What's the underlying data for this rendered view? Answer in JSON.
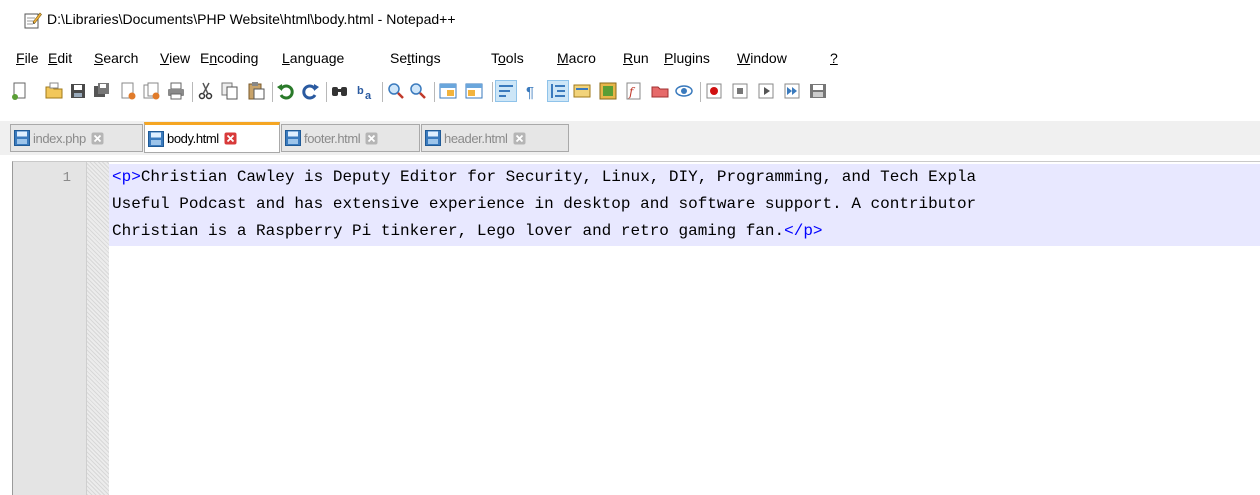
{
  "window": {
    "title": "D:\\Libraries\\Documents\\PHP Website\\html\\body.html - Notepad++",
    "icon": "notepad-plus-plus-icon"
  },
  "menu": [
    {
      "accel": "F",
      "rest": "ile"
    },
    {
      "accel": "E",
      "rest": "dit"
    },
    {
      "accel": "S",
      "rest": "earch"
    },
    {
      "accel": "V",
      "rest": "iew"
    },
    {
      "pre": "E",
      "accel": "n",
      "rest": "coding"
    },
    {
      "accel": "L",
      "rest": "anguage"
    },
    {
      "pre": "Se",
      "accel": "t",
      "rest": "tings"
    },
    {
      "pre": "T",
      "accel": "o",
      "rest": "ols"
    },
    {
      "accel": "M",
      "rest": "acro"
    },
    {
      "accel": "R",
      "rest": "un"
    },
    {
      "accel": "P",
      "rest": "lugins"
    },
    {
      "accel": "W",
      "rest": "indow"
    },
    {
      "accel": "?",
      "rest": ""
    }
  ],
  "toolbar": [
    "new-file-icon",
    "open-file-icon",
    "save-icon",
    "save-all-icon",
    "close-icon",
    "close-all-icon",
    "print-icon",
    "cut-icon",
    "copy-icon",
    "paste-icon",
    "undo-icon",
    "redo-icon",
    "find-icon",
    "replace-icon",
    "zoom-in-icon",
    "zoom-out-icon",
    "sync-vertical-icon",
    "sync-horizontal-icon",
    "word-wrap-icon",
    "show-all-chars-icon",
    "indent-guide-icon",
    "language-icon",
    "document-map-icon",
    "function-list-icon",
    "folder-workspace-icon",
    "monitoring-icon",
    "record-macro-icon",
    "stop-record-icon",
    "play-macro-icon",
    "run-multiple-icon",
    "save-macro-icon"
  ],
  "tabs": [
    {
      "label": "index.php",
      "active": false
    },
    {
      "label": "body.html",
      "active": true
    },
    {
      "label": "footer.html",
      "active": false
    },
    {
      "label": "header.html",
      "active": false
    }
  ],
  "editor": {
    "line_number": "1",
    "open_tag": "<p>",
    "line1": "Christian Cawley is Deputy Editor for Security, Linux, DIY, Programming, and Tech Expla",
    "line2": "Useful Podcast and has extensive experience in desktop and software support. A contributor",
    "line3": "Christian is a Raspberry Pi tinkerer, Lego lover and retro gaming fan.",
    "close_tag": "</p>"
  },
  "colors": {
    "accent_tab": "#f5a623",
    "current_line": "#e8e8ff",
    "tag": "#0000ff"
  }
}
